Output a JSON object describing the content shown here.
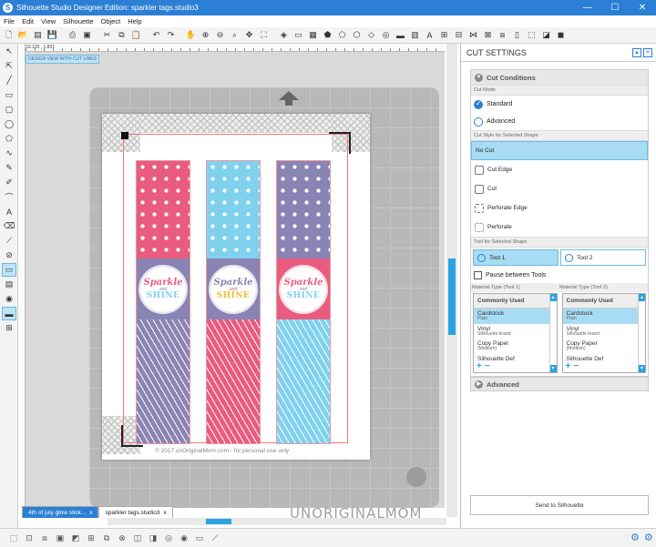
{
  "window": {
    "title": "Silhouette Studio Designer Edition: sparkler tags.studio3",
    "minimize": "—",
    "maximize": "☐",
    "close": "✕"
  },
  "menu": [
    "File",
    "Edit",
    "View",
    "Silhouette",
    "Object",
    "Help"
  ],
  "workspace": {
    "coords": "10.120 , 1.831",
    "cut_lines_label": "DESIGN VIEW WITH CUT LINES",
    "copyright": "© 2017 unOriginalMom.com - for personal use only",
    "tags": [
      {
        "word1": "Sparkle",
        "word2": "and",
        "word3": "SHINE",
        "color_top": "#e95b7f",
        "color_mid": "#8a84b4",
        "color_bottom": "#8a84b4"
      },
      {
        "word1": "Sparkle",
        "word2": "and",
        "word3": "SHINE",
        "color_top": "#7fd1ee",
        "color_mid": "#8a84b4",
        "color_bottom": "#e95b7f"
      },
      {
        "word1": "Sparkle",
        "word2": "and",
        "word3": "SHINE",
        "color_top": "#8a84b4",
        "color_mid": "#e95b7f",
        "color_bottom": "#7fd1ee"
      }
    ]
  },
  "tabs": [
    {
      "label": "4th of july glow stick...",
      "close": "x"
    },
    {
      "label": "sparkler tags.studio3",
      "close": "x"
    }
  ],
  "watermark": "UNORIGINALMOM",
  "panel": {
    "title": "CUT SETTINGS",
    "cut_conditions": "Cut Conditions",
    "cut_mode_label": "Cut Mode",
    "cut_modes": [
      {
        "label": "Standard",
        "on": true
      },
      {
        "label": "Advanced",
        "on": false
      }
    ],
    "cut_style_label": "Cut Style for Selected Shape",
    "cut_styles": [
      "No Cut",
      "Cut Edge",
      "Cut",
      "Perforate Edge",
      "Perforate"
    ],
    "tool_label": "Tool for Selected Shape",
    "tool1": "Tool 1",
    "tool2": "Tool 2",
    "pause": "Pause between Tools",
    "material_label1": "Material Type (Tool 1)",
    "material_label2": "Material Type (Tool 2)",
    "material_header": "Commonly Used",
    "materials": [
      {
        "name": "Cardstock",
        "sub": "Plain"
      },
      {
        "name": "Vinyl",
        "sub": "Silhouette brand"
      },
      {
        "name": "Copy Paper",
        "sub": "(Medium)"
      },
      {
        "name": "Silhouette Def",
        "sub": ""
      }
    ],
    "advanced": "Advanced",
    "send": "Send to Silhouette"
  }
}
